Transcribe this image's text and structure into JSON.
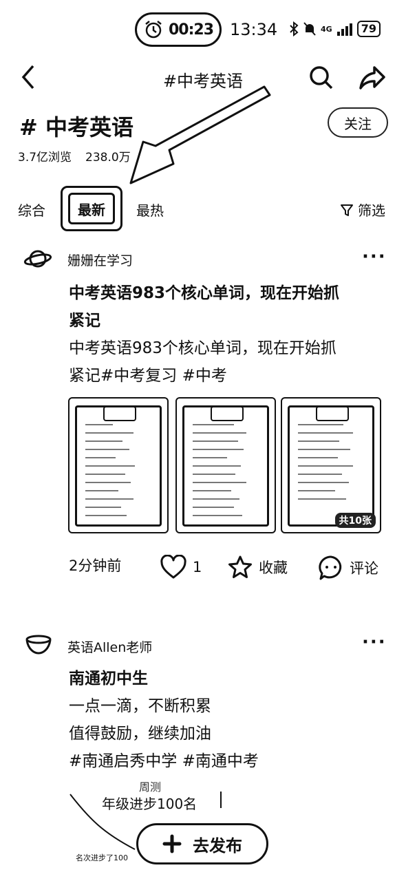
{
  "status_bar": {
    "timer": "00:23",
    "time": "13:34",
    "network": "4G",
    "battery": "79"
  },
  "header": {
    "title": "#中考英语"
  },
  "topic": {
    "hash": "#",
    "name": "中考英语",
    "follow_label": "关注",
    "views": "3.7亿浏览",
    "participants": "238.0万"
  },
  "tabs": [
    {
      "label": "综合"
    },
    {
      "label": "最新",
      "active": true
    },
    {
      "label": "最热"
    }
  ],
  "filter_label": "筛选",
  "posts": [
    {
      "author": "姗姗在学习",
      "title_lines": [
        "中考英语983个核心单词，现在开始抓",
        "紧记"
      ],
      "body_lines": [
        "中考英语983个核心单词，现在开始抓",
        "紧记#中考复习 #中考"
      ],
      "image_count": "共10张",
      "time": "2分钟前",
      "likes": "1",
      "collect_label": "收藏",
      "comment_label": "评论"
    },
    {
      "author": "英语Allen老师",
      "title": "南通初中生",
      "body_lines": [
        "一点一滴，不断积累",
        "值得鼓励，继续加油",
        "#南通启秀中学 #南通中考"
      ],
      "image_text_1": "周测",
      "image_text_2": "年级进步100名",
      "image_text_3": "名次进步了100"
    }
  ],
  "publish_label": "去发布"
}
